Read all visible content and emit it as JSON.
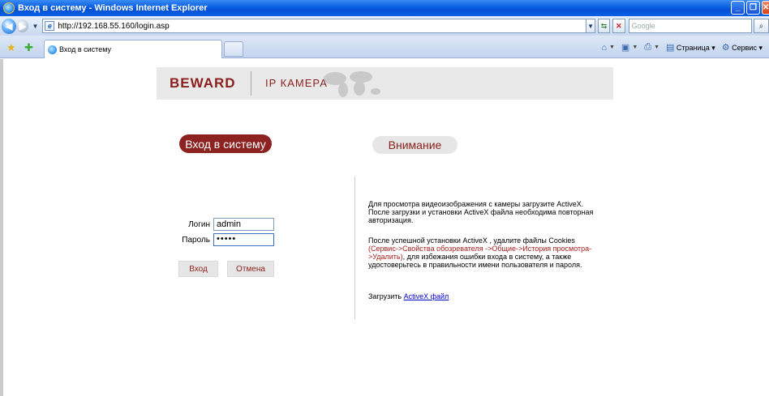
{
  "window": {
    "title": "Вход в систему - Windows Internet Explorer"
  },
  "address": {
    "url": "http://192.168.55.160/login.asp",
    "search_placeholder": "Google"
  },
  "tabs": [
    {
      "label": "Вход в систему"
    }
  ],
  "commandbar": {
    "page_label": "Страница",
    "tools_label": "Сервис"
  },
  "banner": {
    "brand": "BEWARD",
    "subtitle": "IP КАМЕРА"
  },
  "login": {
    "heading": "Вход в систему",
    "login_label": "Логин",
    "login_value": "admin",
    "password_label": "Пароль",
    "password_value": "•••••",
    "submit_label": "Вход",
    "cancel_label": "Отмена"
  },
  "warning": {
    "heading": "Внимание",
    "p1": "Для просмотра видеоизображения с камеры загрузите ActiveX. После загрузки и установки ActiveX файла необходима повторная авторизация.",
    "p2_before": "После успешной установки ActiveX , удалите файлы Cookies",
    "p2_red": "(Сервис->Свойства обозревателя ->Общие->История просмотра->Удалить)",
    "p2_after": ", для избежания ошибки входа в систему, а также удостоверьтесь в правильности имени пользователя и пароля.",
    "download_label": "Загрузить",
    "download_link": "ActiveX файл"
  },
  "colors": {
    "brand_red": "#8b1f1b",
    "pill_red": "#8c2320",
    "banner_gray": "#e9e9e9"
  }
}
